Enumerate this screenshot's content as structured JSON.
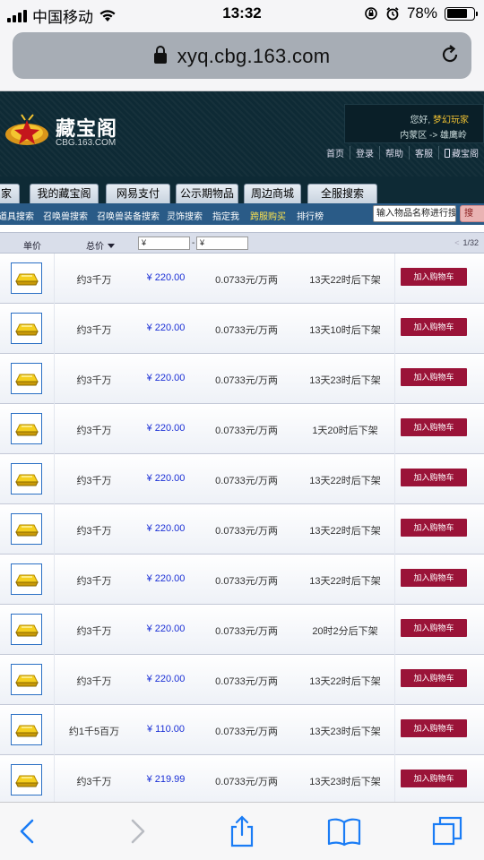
{
  "status_bar": {
    "carrier": "中国移动",
    "time": "13:32",
    "battery": "78%",
    "battery_level": 0.78,
    "icons": [
      "signal-icon",
      "wifi-icon",
      "orientation-lock-icon",
      "alarm-icon",
      "battery-icon"
    ]
  },
  "browser": {
    "url": "xyq.cbg.163.com",
    "icons": [
      "lock-icon",
      "reload-icon"
    ]
  },
  "site": {
    "logo_text": "藏宝阁",
    "logo_domain": "CBG.163.COM",
    "greeting": "您好,",
    "username": "梦幻玩家",
    "server": "内蒙区 -> 雄鹰岭",
    "top_links": [
      "首页",
      "登录",
      "帮助",
      "客服",
      "藏宝阁"
    ]
  },
  "nav_tabs": [
    "家",
    "我的藏宝阁",
    "网易支付",
    "公示期物品",
    "周边商城",
    "全服搜索"
  ],
  "sub_nav": {
    "items": [
      "道具搜索",
      "召唤兽搜索",
      "召唤兽装备搜索",
      "灵饰搜索",
      "指定我",
      "跨服购买",
      "排行榜"
    ],
    "highlight": "跨服购买",
    "search_placeholder": "输入物品名称进行搜索",
    "search_button": "搜"
  },
  "table_header": {
    "unit_price": "单价",
    "total_price": "总价",
    "min_price": "¥",
    "max_price": "¥",
    "dash": "-",
    "page_prev": "<",
    "page": "1/32"
  },
  "rows": [
    {
      "amount": "约3千万",
      "price": "¥ 220.00",
      "rate": "0.0733元/万两",
      "time": "13天22时后下架",
      "button": "加入购物车"
    },
    {
      "amount": "约3千万",
      "price": "¥ 220.00",
      "rate": "0.0733元/万两",
      "time": "13天10时后下架",
      "button": "加入购物车"
    },
    {
      "amount": "约3千万",
      "price": "¥ 220.00",
      "rate": "0.0733元/万两",
      "time": "13天23时后下架",
      "button": "加入购物车"
    },
    {
      "amount": "约3千万",
      "price": "¥ 220.00",
      "rate": "0.0733元/万两",
      "time": "1天20时后下架",
      "button": "加入购物车"
    },
    {
      "amount": "约3千万",
      "price": "¥ 220.00",
      "rate": "0.0733元/万两",
      "time": "13天22时后下架",
      "button": "加入购物车"
    },
    {
      "amount": "约3千万",
      "price": "¥ 220.00",
      "rate": "0.0733元/万两",
      "time": "13天22时后下架",
      "button": "加入购物车"
    },
    {
      "amount": "约3千万",
      "price": "¥ 220.00",
      "rate": "0.0733元/万两",
      "time": "13天22时后下架",
      "button": "加入购物车"
    },
    {
      "amount": "约3千万",
      "price": "¥ 220.00",
      "rate": "0.0733元/万两",
      "time": "20时2分后下架",
      "button": "加入购物车"
    },
    {
      "amount": "约3千万",
      "price": "¥ 220.00",
      "rate": "0.0733元/万两",
      "time": "13天22时后下架",
      "button": "加入购物车"
    },
    {
      "amount": "约1千5百万",
      "price": "¥ 110.00",
      "rate": "0.0733元/万两",
      "time": "13天23时后下架",
      "button": "加入购物车"
    },
    {
      "amount": "约3千万",
      "price": "¥ 219.99",
      "rate": "0.0733元/万两",
      "time": "13天23时后下架",
      "button": "加入购物车"
    }
  ],
  "toolbar": [
    "back-icon",
    "forward-icon",
    "share-icon",
    "bookmarks-icon",
    "tabs-icon"
  ],
  "colors": {
    "header_bg": "#0e2a35",
    "subnav_bg": "#2a5b87",
    "price_blue": "#1a2fd6",
    "cart_button": "#9a1338",
    "ios_blue": "#1a7cf5"
  }
}
